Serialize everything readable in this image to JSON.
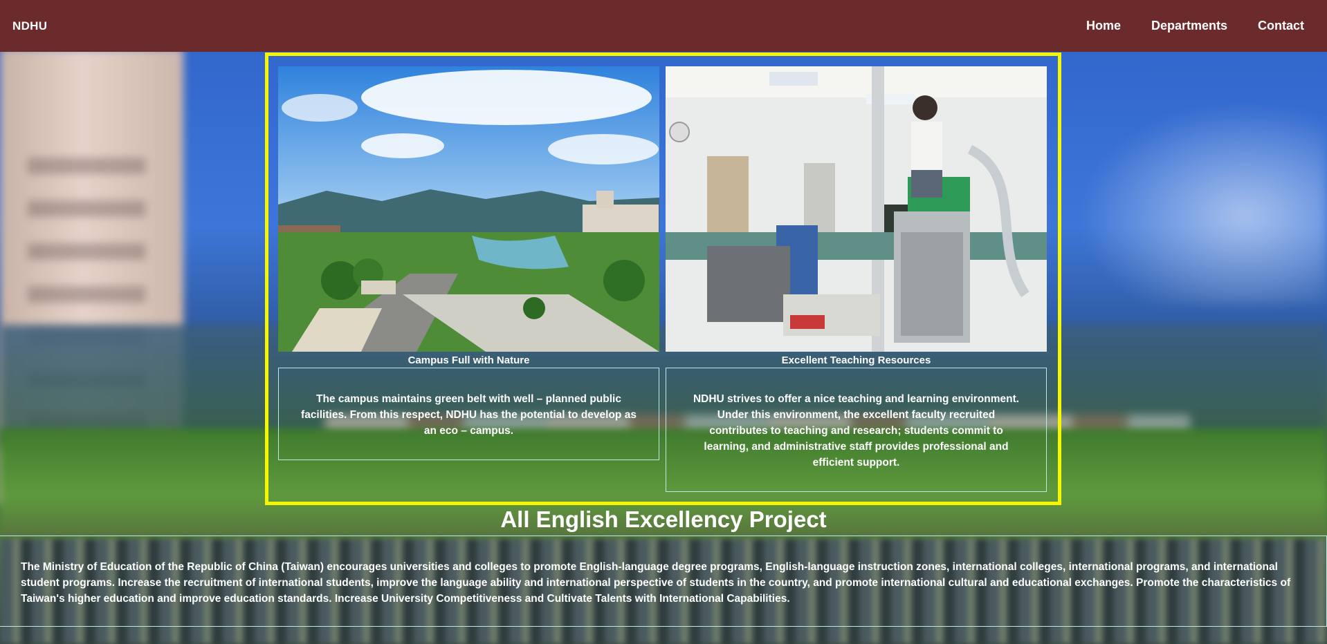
{
  "navbar": {
    "brand": "NDHU",
    "links": [
      {
        "label": "Home"
      },
      {
        "label": "Departments"
      },
      {
        "label": "Contact"
      }
    ]
  },
  "features": [
    {
      "title": "Campus Full with Nature",
      "description": "The campus maintains green belt with well – planned public facilities. From this respect, NDHU has the potential to develop as an eco – campus."
    },
    {
      "title": "Excellent Teaching Resources",
      "description": "NDHU strives to offer a nice teaching and learning environment. Under this environment, the excellent faculty recruited contributes to teaching and research; students commit to learning, and administrative staff provides professional and efficient support."
    }
  ],
  "project": {
    "title": "All English Excellency Project",
    "text": "The Ministry of Education of the Republic of China (Taiwan) encourages universities and colleges to promote English-language degree programs, English-language instruction zones, international colleges, international programs, and international student programs. Increase the recruitment of international students, improve the language ability and international perspective of students in the country, and promote international cultural and educational exchanges. Promote the characteristics of Taiwan's higher education and improve education standards. Increase University Competitiveness and Cultivate Talents with International Capabilities."
  },
  "colors": {
    "navbar_bg": "#6b2a2b",
    "panel_border": "#f6f600",
    "box_border": "#bfe8ea",
    "text": "#ffffff"
  }
}
